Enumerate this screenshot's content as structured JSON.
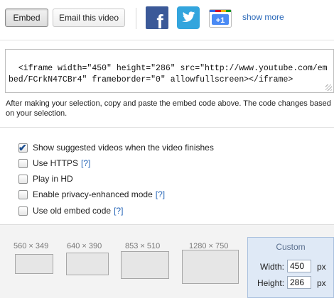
{
  "toolbar": {
    "embed_label": "Embed",
    "email_label": "Email this video",
    "show_more_label": "show more",
    "gplus_label": "+1",
    "facebook_glyph": "f",
    "colors": {
      "facebook": "#3b5998",
      "twitter": "#33a5dd",
      "link": "#2867b8"
    }
  },
  "embed": {
    "code": "<iframe width=\"450\" height=\"286\" src=\"http://www.youtube.com/embed/FCrkN47CBr4\" frameborder=\"0\" allowfullscreen></iframe>",
    "help_text": "After making your selection, copy and paste the embed code above. The code changes based on your selection."
  },
  "options": [
    {
      "label": "Show suggested videos when the video finishes",
      "checked": true,
      "help": ""
    },
    {
      "label": "Use HTTPS",
      "checked": false,
      "help": "[?]"
    },
    {
      "label": "Play in HD",
      "checked": false,
      "help": ""
    },
    {
      "label": "Enable privacy-enhanced mode",
      "checked": false,
      "help": "[?]"
    },
    {
      "label": "Use old embed code",
      "checked": false,
      "help": "[?]"
    }
  ],
  "sizes": {
    "presets": [
      "560 × 349",
      "640 × 390",
      "853 × 510",
      "1280 × 750"
    ],
    "custom_label": "Custom",
    "width_label": "Width:",
    "height_label": "Height:",
    "width_value": "450",
    "height_value": "286",
    "unit": "px"
  }
}
